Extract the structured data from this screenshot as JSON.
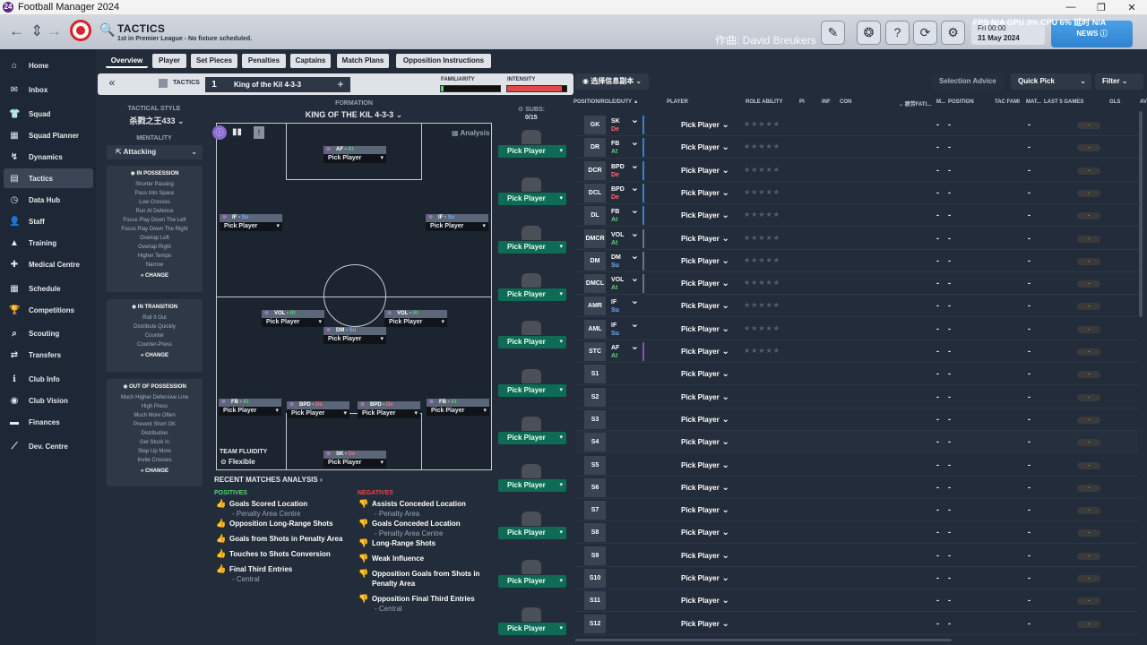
{
  "window": {
    "title": "Football Manager 2024",
    "logo": "24",
    "min": "—",
    "max": "❐",
    "close": "✕"
  },
  "header": {
    "back": "←",
    "updown": "⇕",
    "forward": "→",
    "title": "TACTICS",
    "subtitle": "1st in Premier League - No fixture scheduled.",
    "watermark": "作曲: David Breukers",
    "perf": "FPS  N/A  GPU  3%  CPU  6%  延时  N/A",
    "date_line1": "Fri 00:00",
    "date_line2": "31 May 2024",
    "news_label": "NEWS",
    "icons": {
      "edit": "✎",
      "brain": "❂",
      "help": "?",
      "refresh": "⟳",
      "settings": "⚙",
      "search": "🔍"
    }
  },
  "sidebar": {
    "items": [
      {
        "label": "Home",
        "icon": "⌂"
      },
      {
        "label": "Inbox",
        "icon": "✉"
      },
      {
        "label": "Squad",
        "icon": "👕"
      },
      {
        "label": "Squad Planner",
        "icon": "▦"
      },
      {
        "label": "Dynamics",
        "icon": "↯"
      },
      {
        "label": "Tactics",
        "icon": "▤"
      },
      {
        "label": "Data Hub",
        "icon": "◷"
      },
      {
        "label": "Staff",
        "icon": "👤"
      },
      {
        "label": "Training",
        "icon": "▲"
      },
      {
        "label": "Medical Centre",
        "icon": "✚"
      },
      {
        "label": "Schedule",
        "icon": "▦"
      },
      {
        "label": "Competitions",
        "icon": "🏆"
      },
      {
        "label": "Scouting",
        "icon": "⌕"
      },
      {
        "label": "Transfers",
        "icon": "⇄"
      },
      {
        "label": "Club Info",
        "icon": "ℹ"
      },
      {
        "label": "Club Vision",
        "icon": "◉"
      },
      {
        "label": "Finances",
        "icon": "▬"
      },
      {
        "label": "Dev. Centre",
        "icon": "⟋"
      }
    ]
  },
  "tabs": [
    "Overview",
    "Player",
    "Set Pieces",
    "Penalties",
    "Captains",
    "Match Plans",
    "Opposition Instructions"
  ],
  "tactic_bar": {
    "collapse": "«",
    "label": "TACTICS",
    "slot": "1",
    "name": "King of the Kil 4-3-3",
    "add": "+",
    "familiarity_label": "FAMILIARITY",
    "familiarity_value": 0.05,
    "intensity_label": "INTENSITY",
    "intensity_value": 0.92
  },
  "left_panel": {
    "style_label": "TACTICAL STYLE",
    "style_value": "杀戮之王433",
    "mentality_label": "MENTALITY",
    "mentality_value": "Attacking",
    "in_possession": {
      "title": "IN POSSESSION",
      "items": [
        "Shorter Passing",
        "Pass Into Space",
        "Low Crosses",
        "Run At Defence",
        "Focus Play Down The Left",
        "Focus Play Down The Right",
        "Overlap Left",
        "Overlap Right",
        "Higher Tempo",
        "Narrow"
      ],
      "change": "CHANGE"
    },
    "in_transition": {
      "title": "IN TRANSITION",
      "items": [
        "Roll It Out",
        "Distribute Quickly",
        "Counter",
        "Counter-Press"
      ],
      "change": "CHANGE"
    },
    "out_of_possession": {
      "title": "OUT OF POSSESSION",
      "items": [
        "Much Higher Defensive Line",
        "High Press",
        "Much More Often",
        "Prevent Short GK",
        "Distribution",
        "Get Stuck In",
        "Step Up More",
        "Invite Crosses"
      ],
      "change": "CHANGE"
    }
  },
  "pitch": {
    "formation_label": "FORMATION",
    "formation_value": "KING OF THE KIL 4-3-3",
    "analysis": "Analysis",
    "fluidity_label": "TEAM FLUIDITY",
    "fluidity_value": "Flexible",
    "pick": "Pick Player",
    "positions": [
      {
        "role": "AF",
        "duty": "At",
        "duty_class": "rAt"
      },
      {
        "role": "IF",
        "duty": "Su",
        "duty_class": "rSu"
      },
      {
        "role": "IF",
        "duty": "Su",
        "duty_class": "rSu"
      },
      {
        "role": "VOL",
        "duty": "At",
        "duty_class": "rAt"
      },
      {
        "role": "VOL",
        "duty": "At",
        "duty_class": "rAt"
      },
      {
        "role": "DM",
        "duty": "Su",
        "duty_class": "rSu"
      },
      {
        "role": "FB",
        "duty": "At",
        "duty_class": "rAt"
      },
      {
        "role": "BPD",
        "duty": "De",
        "duty_class": "rDe"
      },
      {
        "role": "BPD",
        "duty": "De",
        "duty_class": "rDe"
      },
      {
        "role": "FB",
        "duty": "At",
        "duty_class": "rAt"
      },
      {
        "role": "SK",
        "duty": "De",
        "duty_class": "rDe"
      }
    ]
  },
  "subs": {
    "label": "SUBS:",
    "count": "0/15",
    "pick": "Pick Player"
  },
  "analysis": {
    "title": "RECENT MATCHES ANALYSIS",
    "positives_label": "POSITIVES",
    "negatives_label": "NEGATIVES",
    "positives": [
      {
        "text": "Goals Scored Location",
        "sub": "- Penalty Area Centre",
        "color": "#5ad36e"
      },
      {
        "text": "Opposition Long-Range Shots",
        "sub": "",
        "color": "#f2d23a"
      },
      {
        "text": "Goals from Shots in Penalty Area",
        "sub": "",
        "color": "#f2d23a"
      },
      {
        "text": "Touches to Shots Conversion",
        "sub": "",
        "color": "#f2d23a"
      },
      {
        "text": "Final Third Entries",
        "sub": "- Central",
        "color": "#f2d23a"
      }
    ],
    "negatives": [
      {
        "text": "Assists Conceded Location",
        "sub": "- Penalty Area",
        "color": "#e24848"
      },
      {
        "text": "Goals Conceded Location",
        "sub": "- Penalty Area Centre",
        "color": "#e24848"
      },
      {
        "text": "Long-Range Shots",
        "sub": "",
        "color": "#e24848"
      },
      {
        "text": "Weak Influence",
        "sub": "",
        "color": "#f08a2e"
      },
      {
        "text": "Opposition Goals from Shots in Penalty Area",
        "sub": "",
        "color": "#f2d23a"
      },
      {
        "text": "Opposition Final Third Entries",
        "sub": "- Central",
        "color": "#f2d23a"
      }
    ]
  },
  "right": {
    "view_label": "选择信息副本",
    "selection_advice": "Selection Advice",
    "quick_pick": "Quick Pick",
    "filter": "Filter",
    "columns": [
      "POSITION/ROLE/DUTY ▲",
      "PLAYER",
      "ROLE ABILITY",
      "PI",
      "INF",
      "CON",
      "⌄ 疲劳FATI...",
      "M...",
      "POSITION",
      "TAC FAMI",
      "MAT...",
      "LAST 5 GAMES",
      "GLS",
      "AV"
    ],
    "pick": "Pick Player",
    "stars": "★★★★★",
    "dash": "-",
    "rows": [
      {
        "pos": "GK",
        "role": "SK",
        "duty": "De",
        "duty_class": "rDe",
        "stripe": "#3a7fd0"
      },
      {
        "pos": "DR",
        "role": "FB",
        "duty": "At",
        "duty_class": "rAt",
        "stripe": "#3a7fd0"
      },
      {
        "pos": "DCR",
        "role": "BPD",
        "duty": "De",
        "duty_class": "rDe",
        "stripe": "#3a7fd0"
      },
      {
        "pos": "DCL",
        "role": "BPD",
        "duty": "De",
        "duty_class": "rDe",
        "stripe": "#3a7fd0"
      },
      {
        "pos": "DL",
        "role": "FB",
        "duty": "At",
        "duty_class": "rAt",
        "stripe": "#3a7fd0"
      },
      {
        "pos": "DMCR",
        "role": "VOL",
        "duty": "At",
        "duty_class": "rAt",
        "stripe": "#6a7486"
      },
      {
        "pos": "DM",
        "role": "DM",
        "duty": "Su",
        "duty_class": "rSu",
        "stripe": "#6a7486"
      },
      {
        "pos": "DMCL",
        "role": "VOL",
        "duty": "At",
        "duty_class": "rAt",
        "stripe": "#6a7486"
      },
      {
        "pos": "AMR",
        "role": "IF",
        "duty": "Su",
        "duty_class": "rSu",
        "stripe": ""
      },
      {
        "pos": "AML",
        "role": "IF",
        "duty": "Su",
        "duty_class": "rSu",
        "stripe": ""
      },
      {
        "pos": "STC",
        "role": "AF",
        "duty": "At",
        "duty_class": "rAt",
        "stripe": "#7a5aa8"
      },
      {
        "pos": "S1",
        "role": "",
        "duty": "",
        "duty_class": "",
        "stripe": ""
      },
      {
        "pos": "S2",
        "role": "",
        "duty": "",
        "duty_class": "",
        "stripe": ""
      },
      {
        "pos": "S3",
        "role": "",
        "duty": "",
        "duty_class": "",
        "stripe": ""
      },
      {
        "pos": "S4",
        "role": "",
        "duty": "",
        "duty_class": "",
        "stripe": ""
      },
      {
        "pos": "S5",
        "role": "",
        "duty": "",
        "duty_class": "",
        "stripe": ""
      },
      {
        "pos": "S6",
        "role": "",
        "duty": "",
        "duty_class": "",
        "stripe": ""
      },
      {
        "pos": "S7",
        "role": "",
        "duty": "",
        "duty_class": "",
        "stripe": ""
      },
      {
        "pos": "S8",
        "role": "",
        "duty": "",
        "duty_class": "",
        "stripe": ""
      },
      {
        "pos": "S9",
        "role": "",
        "duty": "",
        "duty_class": "",
        "stripe": ""
      },
      {
        "pos": "S10",
        "role": "",
        "duty": "",
        "duty_class": "",
        "stripe": ""
      },
      {
        "pos": "S11",
        "role": "",
        "duty": "",
        "duty_class": "",
        "stripe": ""
      },
      {
        "pos": "S12",
        "role": "",
        "duty": "",
        "duty_class": "",
        "stripe": ""
      }
    ]
  }
}
